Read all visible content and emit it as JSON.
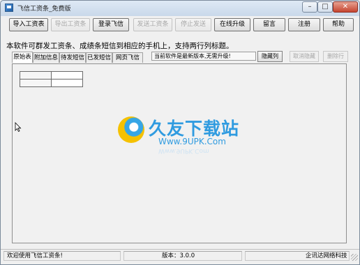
{
  "window": {
    "title": "飞信工资条_免费版"
  },
  "caption_buttons": {
    "minimize": "–",
    "maximize": "□",
    "close": "✕"
  },
  "toolbar": {
    "import_salary": "导入工资表",
    "export_salary": "导出工资条",
    "login_fetion": "登录飞信",
    "send_salary": "发送工资条",
    "stop_send": "停止发送",
    "online_upgrade": "在线升级",
    "leave_message": "留言",
    "register": "注册",
    "help": "帮助"
  },
  "description": "本软件可群发工资条、成绩条短信到相应的手机上，支持两行列标题。",
  "tabs": [
    "原始表",
    "附加信息",
    "待发短信",
    "已发短信",
    "网页飞信"
  ],
  "active_tab": 0,
  "status_message": "当前软件是最新版本,无需升级!",
  "grid_buttons": {
    "hide_columns": "隐藏列",
    "cancel_hide": "取消隐藏",
    "delete_row": "删除行"
  },
  "watermark": {
    "brand": "久友下载站",
    "url": "Www.9UPK.Com"
  },
  "statusbar": {
    "welcome": "欢迎使用飞信工资条!",
    "version": "版本：3.0.0",
    "company": "企讯达网络科技"
  },
  "icons": {
    "app": "app-icon",
    "logo": "watermark-logo-icon",
    "cursor": "mouse-cursor-icon"
  }
}
